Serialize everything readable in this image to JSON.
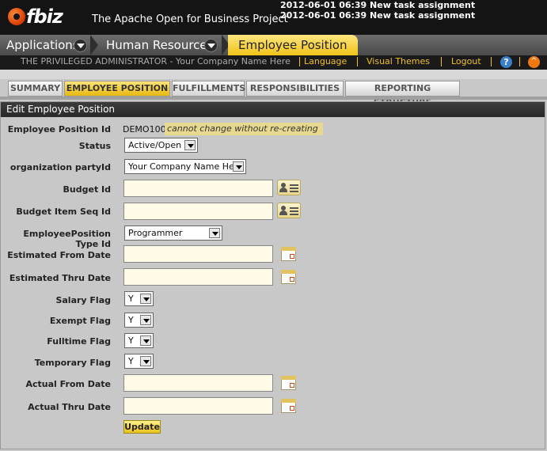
{
  "header": {
    "logo_text": "fbiz",
    "tagline": "The Apache Open for Business Project",
    "notices": [
      "2012-06-01 06:39 New task assignment",
      "2012-06-01 06:39 New task assignment"
    ]
  },
  "appbar": {
    "applications": "Applications",
    "human_resources": "Human Resources",
    "current": "Employee Position"
  },
  "userbar": {
    "admin": "THE PRIVILEGED ADMINISTRATOR - Your Company Name Here",
    "language": "Language",
    "visual_themes": "Visual Themes",
    "logout": "Logout",
    "help": "?",
    "alert": "^"
  },
  "subtabs": [
    "SUMMARY",
    "EMPLOYEE POSITION",
    "FULFILLMENTS",
    "RESPONSIBILITIES",
    "REPORTING STRUCTURE"
  ],
  "panel": {
    "title": "Edit Employee Position"
  },
  "form": {
    "position_id_label": "Employee Position Id",
    "position_id_value": "DEMO100",
    "position_id_note": "cannot change without re-creating",
    "status_label": "Status",
    "status_value": "Active/Open",
    "org_label": "organization partyId",
    "org_value": "Your Company Name Here",
    "budget_id_label": "Budget Id",
    "budget_item_label": "Budget Item Seq Id",
    "type_label": "EmployeePosition Type Id",
    "type_value": "Programmer",
    "est_from_label": "Estimated From Date",
    "est_thru_label": "Estimated Thru Date",
    "salary_label": "Salary Flag",
    "salary_value": "Y",
    "exempt_label": "Exempt Flag",
    "exempt_value": "Y",
    "fulltime_label": "Fulltime Flag",
    "fulltime_value": "Y",
    "temporary_label": "Temporary Flag",
    "temporary_value": "Y",
    "actual_from_label": "Actual From Date",
    "actual_thru_label": "Actual Thru Date",
    "update_label": "Update"
  },
  "colors": {
    "accent": "#f0c218",
    "header_bg": "#141414",
    "field_bg": "#fffbe6"
  },
  "icons": [
    "lookup-icon",
    "calendar-icon",
    "help-icon",
    "alert-icon",
    "chevron-down-icon"
  ]
}
